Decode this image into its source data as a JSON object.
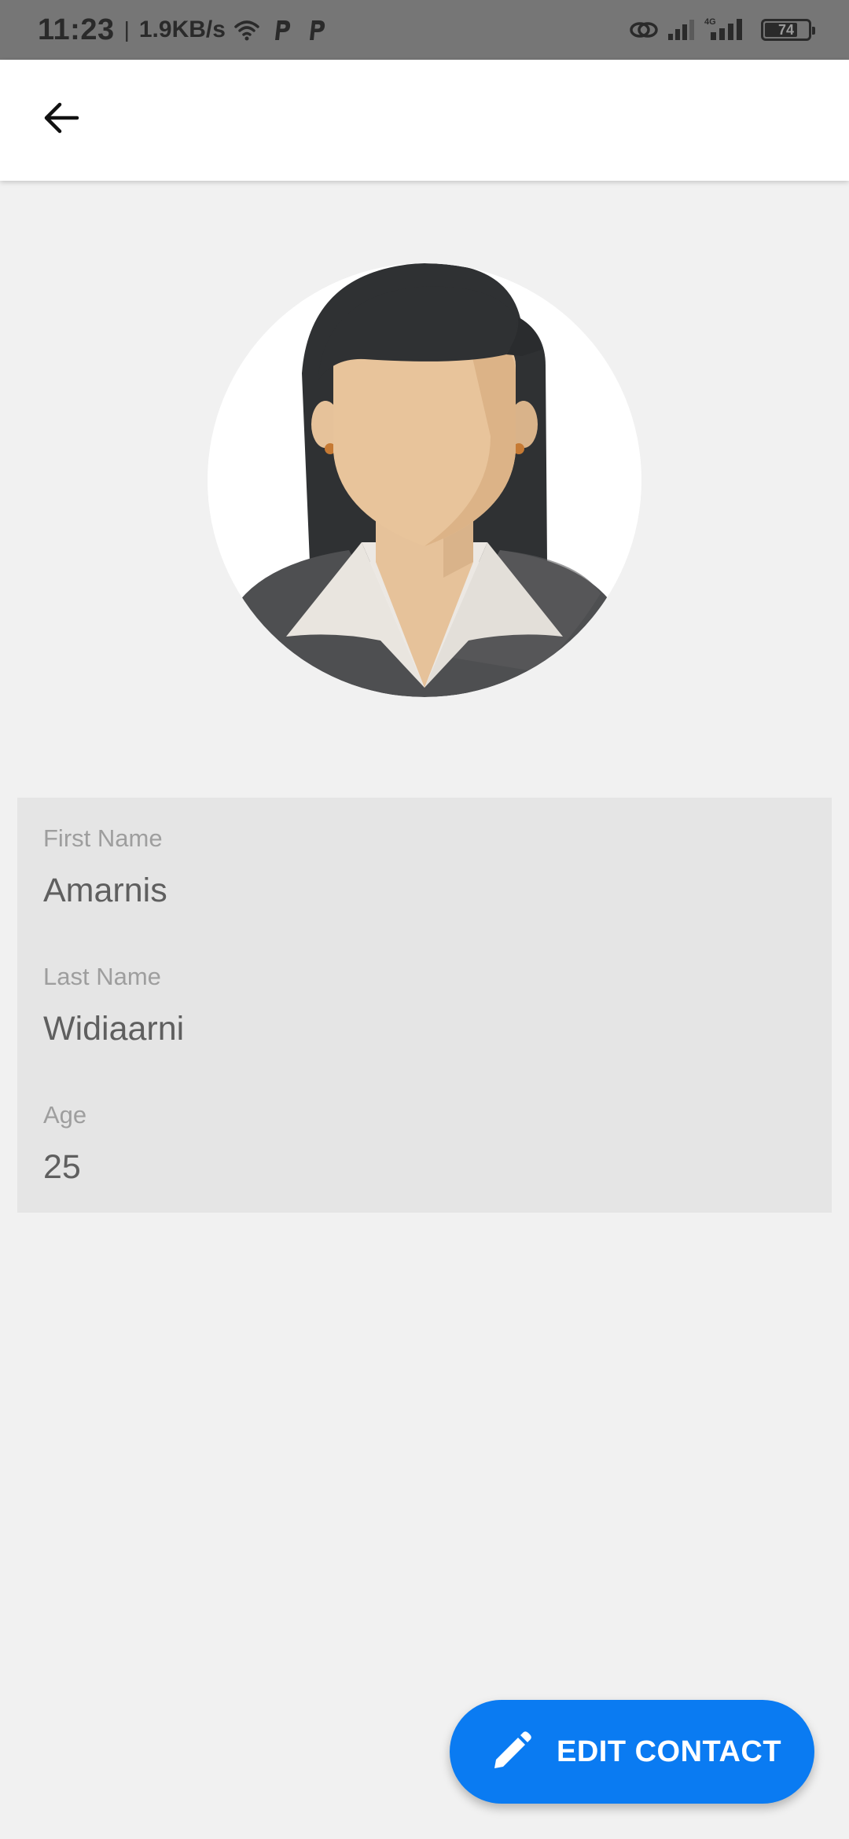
{
  "status_bar": {
    "time": "11:23",
    "separator": "|",
    "network_speed": "1.9KB/s",
    "network_type": "4G",
    "battery_level": "74",
    "icons": [
      "wifi-icon",
      "parking-app-icon",
      "parking-app-icon",
      "link-icon",
      "signal-icon",
      "signal-4g-icon",
      "battery-icon"
    ]
  },
  "app_bar": {
    "back_icon": "arrow-back-icon"
  },
  "avatar": {
    "icon": "female-avatar-illustration"
  },
  "contact": {
    "fields": [
      {
        "label": "First Name",
        "value": "Amarnis"
      },
      {
        "label": "Last Name",
        "value": "Widiaarni"
      },
      {
        "label": "Age",
        "value": "25"
      }
    ]
  },
  "fab": {
    "label": "EDIT CONTACT",
    "icon": "pencil-icon",
    "color": "#0a7bf2"
  },
  "colors": {
    "background": "#f1f1f1",
    "status_bar": "#767676",
    "card": "#e5e5e5",
    "accent": "#0a7bf2"
  }
}
